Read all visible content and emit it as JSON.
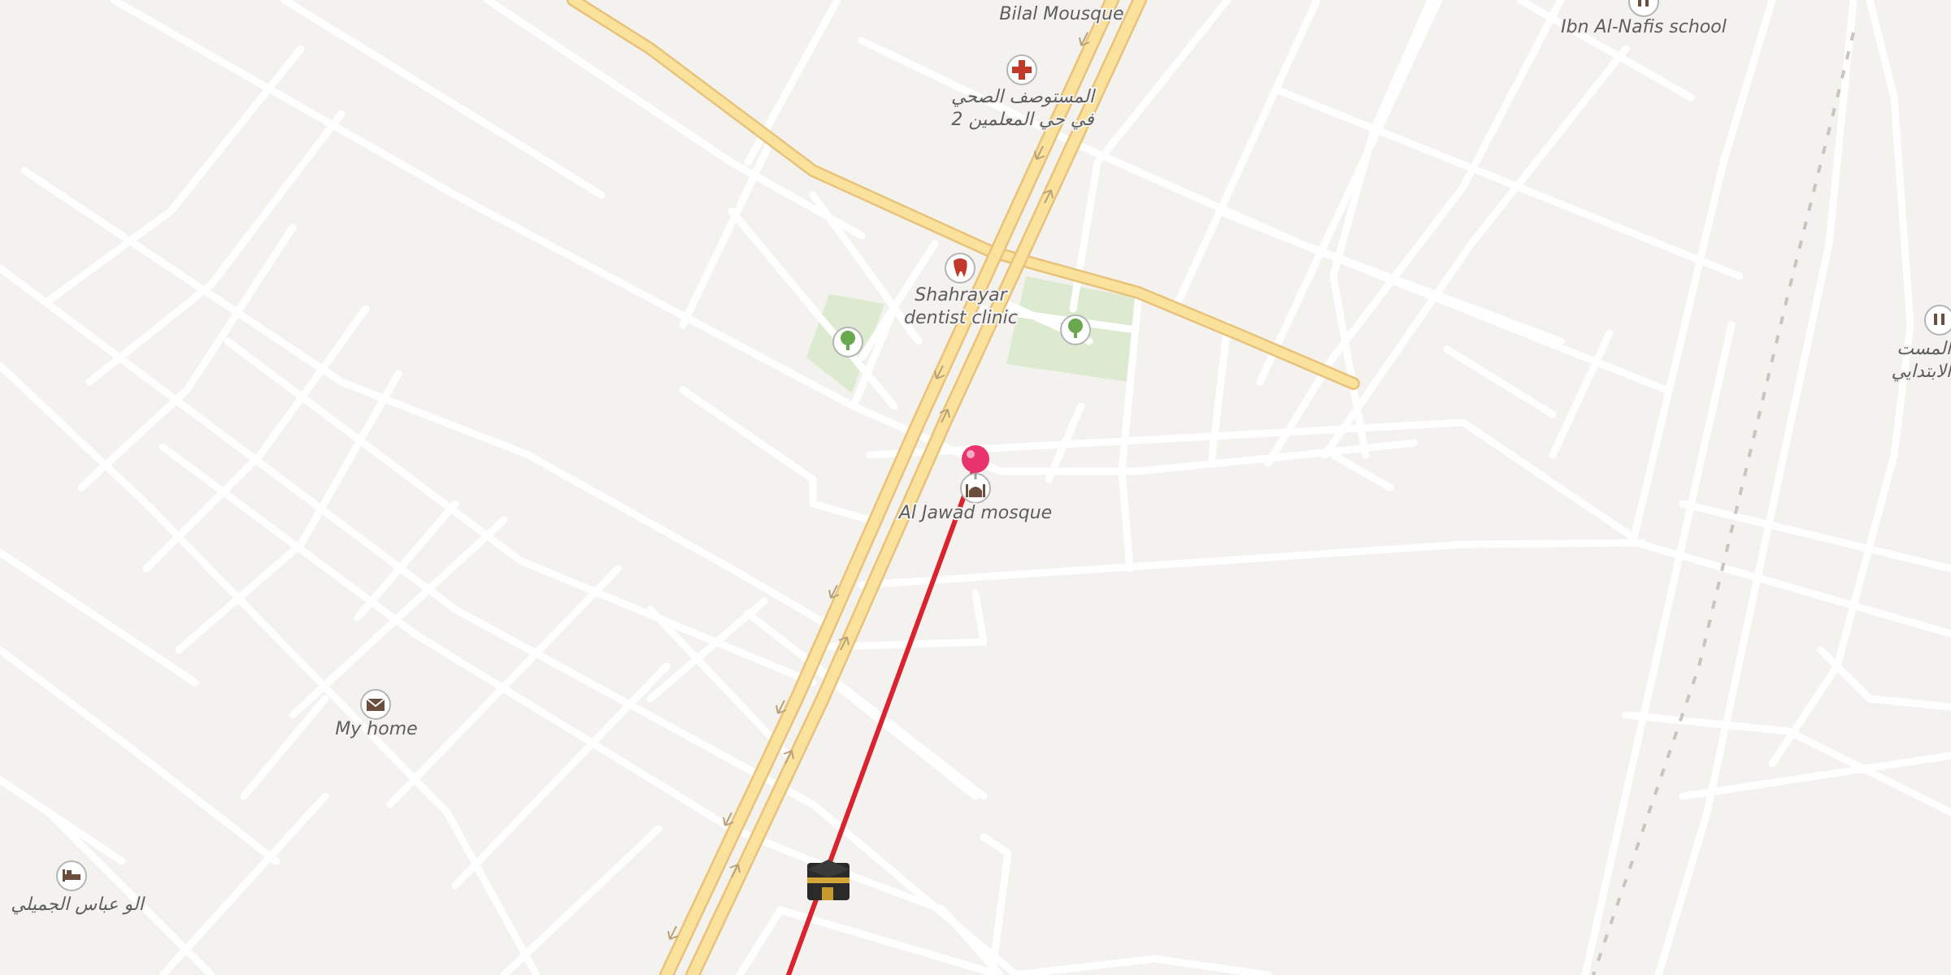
{
  "map": {
    "colors": {
      "background": "#f4f2ef",
      "minor_road": "#ffffff",
      "major_road": "#fbe29c",
      "major_road_casing": "#e8c27a",
      "park": "#dcebd0",
      "route": "#d9232e",
      "pin": "#e8336e",
      "railway": "#c9c4bf"
    },
    "pois": [
      {
        "id": "bilal",
        "label": "Bilal Mousque",
        "icon": "mosque-icon"
      },
      {
        "id": "health_center",
        "label_line1": "المستوصف الصحي",
        "label_line2": "في حي المعلمين 2",
        "icon": "medical-cross-icon"
      },
      {
        "id": "ibn_nafis",
        "label": "Ibn Al-Nafis school",
        "icon": "school-icon"
      },
      {
        "id": "dentist",
        "label_line1": "Shahrayar",
        "label_line2": "dentist clinic",
        "icon": "tooth-icon"
      },
      {
        "id": "park_west",
        "icon": "tree-icon"
      },
      {
        "id": "park_east",
        "icon": "tree-icon"
      },
      {
        "id": "jawad",
        "label": "Al Jawad mosque",
        "icon": "mosque-icon"
      },
      {
        "id": "home",
        "label": "My home",
        "icon": "envelope-icon"
      },
      {
        "id": "hotel",
        "label": "الو عباس الجميلي",
        "icon": "bed-icon"
      },
      {
        "id": "school_east",
        "label_line1": "المست",
        "label_line2": "الابتدايي",
        "icon": "school-icon"
      }
    ],
    "markers": {
      "location_pin": "location-pin-icon",
      "qibla_target": "kaaba-icon"
    }
  }
}
